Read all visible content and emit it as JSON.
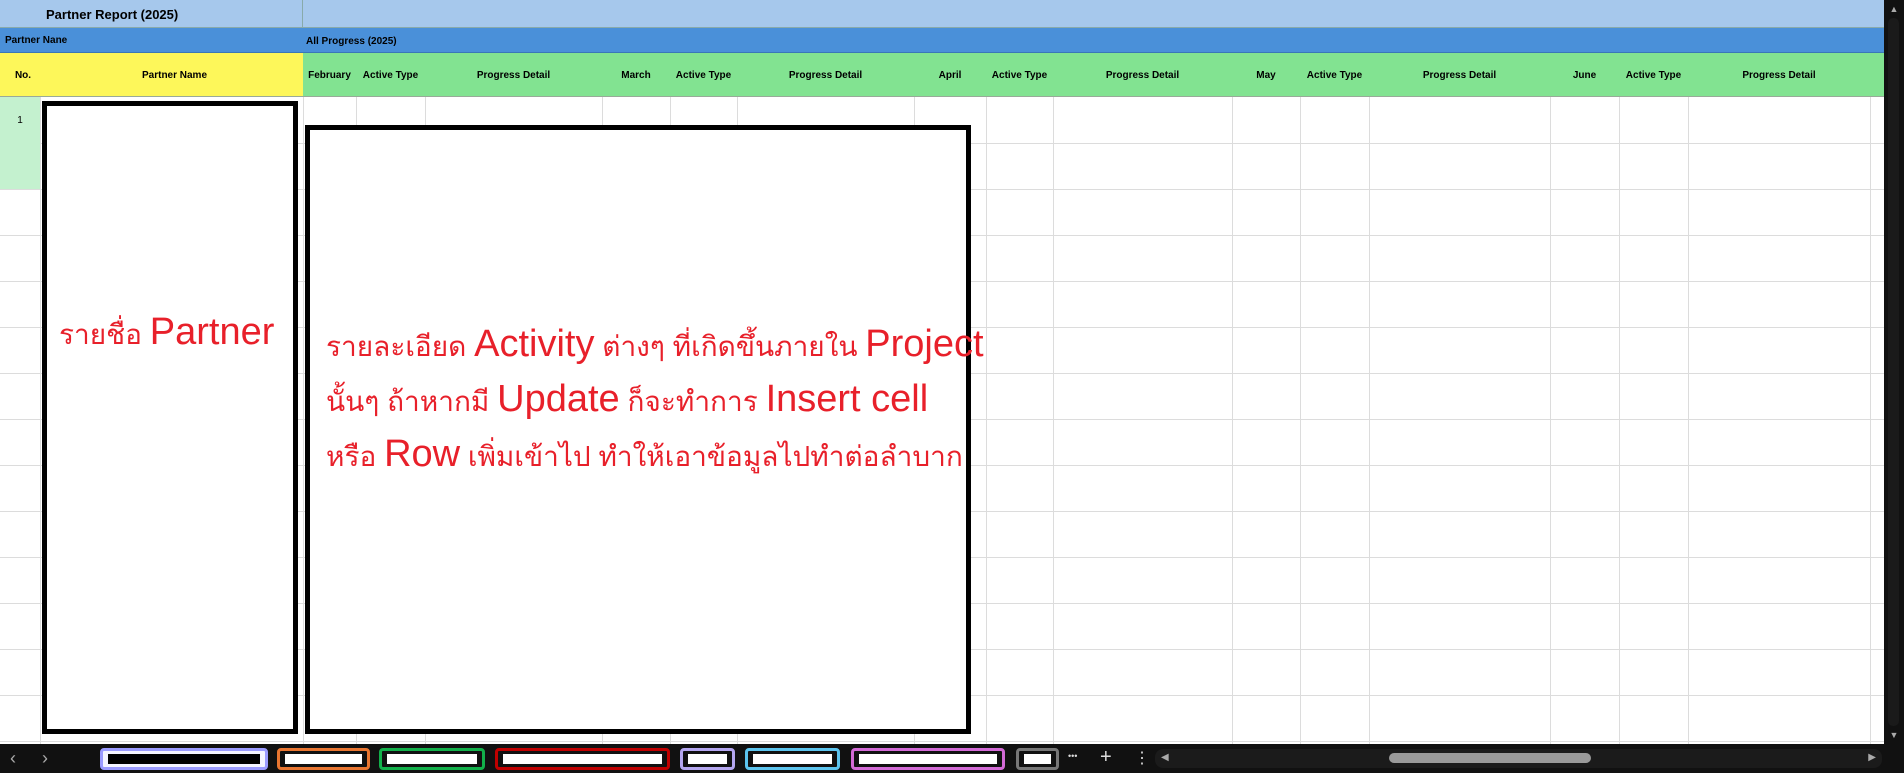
{
  "sheet": {
    "title": "Partner Report (2025)",
    "group_left": "Partner Nane",
    "group_right": "All Progress (2025)",
    "col_no": "No.",
    "col_partner": "Partner Name",
    "columns": [
      "February",
      "Active Type",
      "Progress Detail",
      "March",
      "Active Type",
      "Progress Detail",
      "April",
      "Active Type",
      "Progress Detail",
      "May",
      "Active Type",
      "Progress Detail",
      "June",
      "Active Type",
      "Progress Detail"
    ],
    "rows": [
      {
        "no": "1"
      }
    ]
  },
  "annotations": {
    "left": [
      {
        "t": "รายชื่อ ",
        "big": false
      },
      {
        "t": "Partner",
        "big": true
      }
    ],
    "right_lines": [
      [
        {
          "t": "รายละเอียด ",
          "big": false
        },
        {
          "t": "Activity",
          "big": true
        },
        {
          "t": " ต่างๆ ที่เกิดขึ้นภายใน ",
          "big": false
        },
        {
          "t": "Project",
          "big": true
        }
      ],
      [
        {
          "t": "นั้นๆ ถ้าหากมี ",
          "big": false
        },
        {
          "t": "Update",
          "big": true
        },
        {
          "t": " ก็จะทำการ ",
          "big": false
        },
        {
          "t": "Insert cell",
          "big": true
        }
      ],
      [
        {
          "t": "หรือ ",
          "big": false
        },
        {
          "t": "Row",
          "big": true
        },
        {
          "t": " เพิ่มเข้าไป ทำให้เอาข้อมูลไปทำต่อลำบาก",
          "big": false
        }
      ]
    ],
    "color": "#e8202a"
  },
  "tabs": [
    {
      "color": "#9b9bff"
    },
    {
      "color": "#e87530"
    },
    {
      "color": "#12b04a"
    },
    {
      "color": "#c00000"
    },
    {
      "color": "#b4a6f0"
    },
    {
      "color": "#5cc4ee"
    },
    {
      "color": "#d36ad6"
    },
    {
      "color": "#777777"
    }
  ],
  "controls": {
    "more": "•••",
    "add": "+",
    "menu": "⋮",
    "prev": "‹",
    "next": "›",
    "left_arrow": "◀",
    "right_arrow": "▶",
    "up_arrow": "▲",
    "down_arrow": "▼"
  }
}
